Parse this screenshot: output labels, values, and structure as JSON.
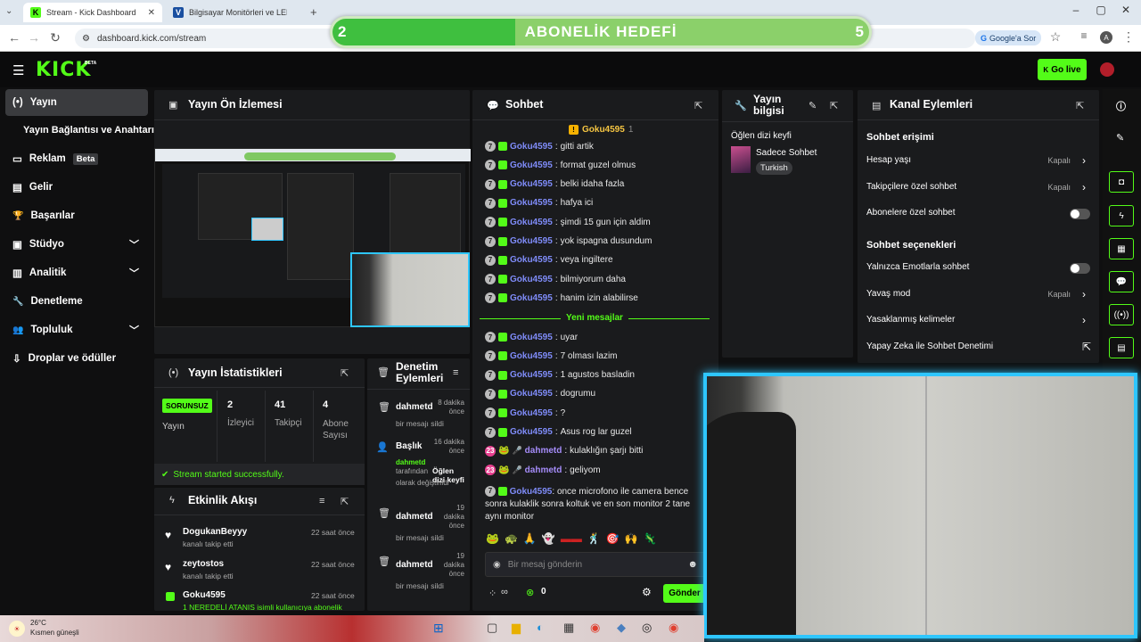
{
  "browser": {
    "tabs": [
      {
        "title": "Stream - Kick Dashboard",
        "active": true
      },
      {
        "title": "Bilgisayar Monitörleri ve LED-IP",
        "active": false
      }
    ],
    "url": "dashboard.kick.com/stream",
    "google_btn": "Google'a Sor",
    "profile_initial": "A"
  },
  "goal": {
    "label": "ABONELİK HEDEFİ",
    "current": "2",
    "target": "5",
    "progress": 0.4
  },
  "header": {
    "logo": "KICK",
    "logo_badge": "BETA",
    "go_live": "Go live"
  },
  "sidebar": {
    "items": [
      {
        "label": "Yayın",
        "icon": "(•)"
      },
      {
        "label": "Yayın Bağlantısı ve Anahtarı",
        "icon": ""
      },
      {
        "label": "Reklam",
        "icon": "▭",
        "badge": "Beta"
      },
      {
        "label": "Gelir",
        "icon": "▤"
      },
      {
        "label": "Başarılar",
        "icon": "🏆"
      },
      {
        "label": "Stüdyo",
        "icon": "▣"
      },
      {
        "label": "Analitik",
        "icon": "▥"
      },
      {
        "label": "Denetleme",
        "icon": "🔧"
      },
      {
        "label": "Topluluk",
        "icon": "👥"
      },
      {
        "label": "Droplar ve ödüller",
        "icon": "⇩"
      }
    ]
  },
  "preview": {
    "title": "Yayın Ön İzlemesi"
  },
  "stats": {
    "title": "Yayın İstatistikleri",
    "status": "SORUNSUZ",
    "status_label": "Yayın",
    "viewers": "2",
    "viewers_label": "İzleyici",
    "followers": "41",
    "followers_label": "Takipçi",
    "subs": "4",
    "subs_label": "Abone Sayısı",
    "success": "Stream started successfully."
  },
  "activity": {
    "title": "Etkinlik Akışı",
    "items": [
      {
        "name": "DogukanBeyyy",
        "desc": "kanalı takip etti",
        "time": "22 saat önce"
      },
      {
        "name": "zeytostos",
        "desc": "kanalı takip etti",
        "time": "22 saat önce"
      },
      {
        "name": "Goku4595",
        "desc": "1 NEREDELİ ATANIS isimli kullanıcıya abonelik",
        "time": "22 saat önce"
      }
    ]
  },
  "moderation": {
    "title": "Denetim Eylemleri",
    "items": [
      {
        "name": "dahmetd",
        "desc": "bir mesajı sildi",
        "time": "8 dakika önce"
      },
      {
        "name": "Başlık",
        "desc_user": "dahmetd",
        "desc_mid": "tarafından",
        "desc_bold": "Öğlen dizi keyfi",
        "desc_tail": "olarak değiştirildi",
        "time": "16 dakika önce"
      },
      {
        "name": "dahmetd",
        "desc": "bir mesajı sildi",
        "time": "19 dakika önce"
      },
      {
        "name": "dahmetd",
        "desc": "bir mesajı sildi",
        "time": "19 dakika önce"
      }
    ]
  },
  "chat": {
    "title": "Sohbet",
    "pinned_user": "Goku4595",
    "pinned_count": "1",
    "messages": [
      {
        "user": "Goku4595",
        "text": "gitti artik"
      },
      {
        "user": "Goku4595",
        "text": "format guzel olmus"
      },
      {
        "user": "Goku4595",
        "text": "belki idaha fazla"
      },
      {
        "user": "Goku4595",
        "text": "hafya ici"
      },
      {
        "user": "Goku4595",
        "text": "şimdi 15 gun için aldim"
      },
      {
        "user": "Goku4595",
        "text": "yok ispagna dusundum"
      },
      {
        "user": "Goku4595",
        "text": "veya ingiltere"
      },
      {
        "user": "Goku4595",
        "text": "bilmiyorum daha"
      },
      {
        "user": "Goku4595",
        "text": "hanim izin alabilirse"
      }
    ],
    "new_messages_label": "Yeni mesajlar",
    "new_messages": [
      {
        "user": "Goku4595",
        "text": "uyar"
      },
      {
        "user": "Goku4595",
        "text": "7 olması lazim"
      },
      {
        "user": "Goku4595",
        "text": "1 agustos basladin"
      },
      {
        "user": "Goku4595",
        "text": "dogrumu"
      },
      {
        "user": "Goku4595",
        "text": "?"
      },
      {
        "user": "Goku4595",
        "text": "Asus rog lar guzel"
      },
      {
        "user": "dahmetd",
        "text": "kulaklığın şarjı bitti",
        "mod": true
      },
      {
        "user": "dahmetd",
        "text": "geliyom",
        "mod": true
      }
    ],
    "last_user": "Goku4595",
    "last_text": "once microfono ile camera bence sonra kulaklik sonra koltuk ve en son monitor 2 tane aynı monitor",
    "input_placeholder": "Bir mesaj gönderin",
    "send": "Gönder",
    "points": "0",
    "infinity": "∞"
  },
  "streaminfo": {
    "title": "Yayın bilgisi",
    "stream_title": "Öğlen dizi keyfi",
    "category": "Sadece Sohbet",
    "tag": "Turkish"
  },
  "channel": {
    "title": "Kanal Eylemleri",
    "section1": "Sohbet erişimi",
    "rows1": [
      {
        "label": "Hesap yaşı",
        "value": "Kapalı",
        "type": "chevron"
      },
      {
        "label": "Takipçilere özel sohbet",
        "value": "Kapalı",
        "type": "chevron"
      },
      {
        "label": "Abonelere özel sohbet",
        "value": "",
        "type": "toggle"
      }
    ],
    "section2": "Sohbet seçenekleri",
    "rows2": [
      {
        "label": "Yalnızca Emotlarla sohbet",
        "value": "",
        "type": "toggle"
      },
      {
        "label": "Yavaş mod",
        "value": "Kapalı",
        "type": "chevron"
      },
      {
        "label": "Yasaklanmış kelimeler",
        "value": "",
        "type": "chevron"
      },
      {
        "label": "Yapay Zeka ile Sohbet Denetimi",
        "value": "",
        "type": "external"
      }
    ]
  },
  "taskbar": {
    "weather_temp": "26°C",
    "weather_desc": "Kısmen güneşli"
  }
}
